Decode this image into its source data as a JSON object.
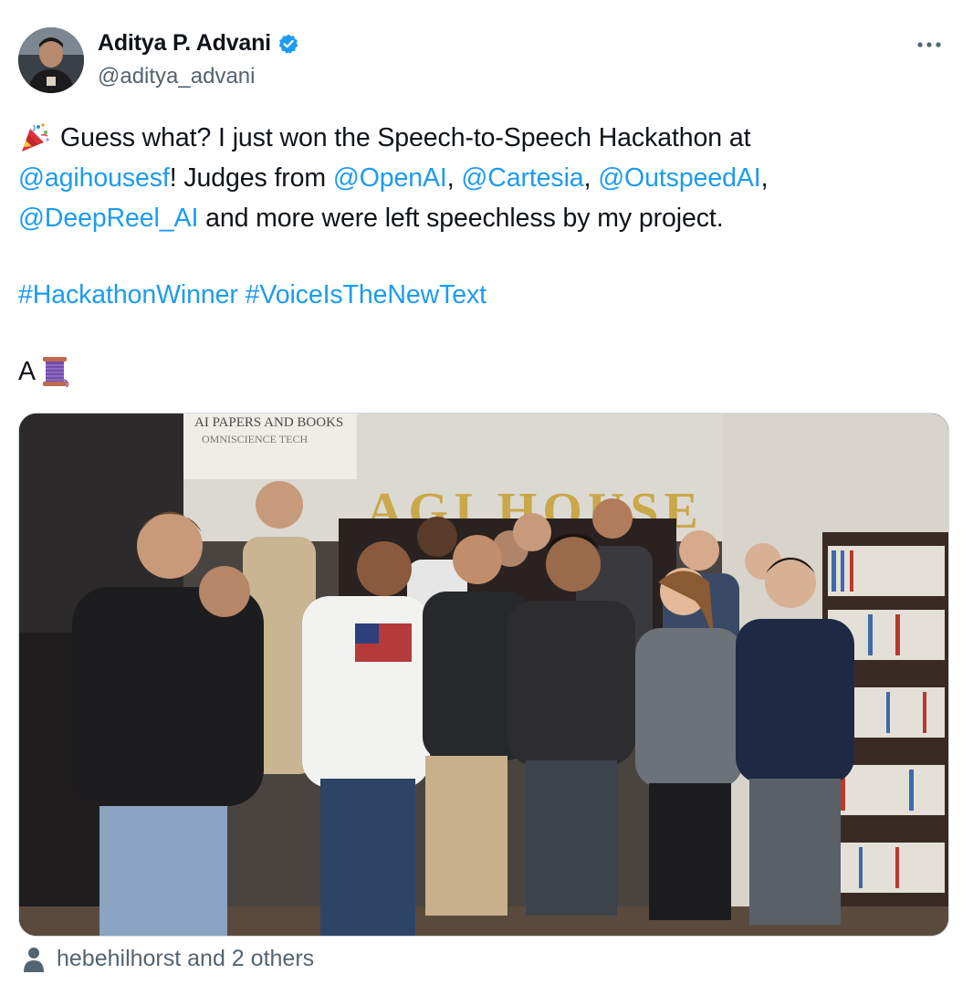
{
  "author": {
    "display_name": "Aditya P. Advani",
    "handle": "@aditya_advani",
    "verified": true,
    "verified_color": "#1d9bf0"
  },
  "menu": {
    "icon": "more-horizontal-icon"
  },
  "tweet": {
    "line1_text": "Guess what? I just won the Speech-to-Speech Hackathon at",
    "line2_mention": "@agihousesf",
    "line2_text_a": "! Judges from ",
    "line2_mention_openai": "@OpenAI",
    "comma1": ", ",
    "line2_mention_cartesia": "@Cartesia",
    "comma2": ", ",
    "line2_mention_outspeed": "@OutspeedAI",
    "comma3": ",",
    "line3_mention_deepreel": "@DeepReel_AI",
    "line3_text": " and more were left speechless by my project.",
    "hashtag1": "#HackathonWinner",
    "space": " ",
    "hashtag2": "#VoiceIsTheNewText",
    "final_text": "A",
    "emoji_start": "party-popper-icon",
    "emoji_end": "thread-spool-icon",
    "link_color": "#1d9bf0"
  },
  "media": {
    "sign_text_top": "AI PAPERS AND BOOKS",
    "sign_text_sub": "OMNISCIENCE TECH",
    "wall_letters": "AGI HOUSE"
  },
  "tagged": {
    "icon": "person-icon",
    "text": "hebehilhorst and 2 others"
  }
}
